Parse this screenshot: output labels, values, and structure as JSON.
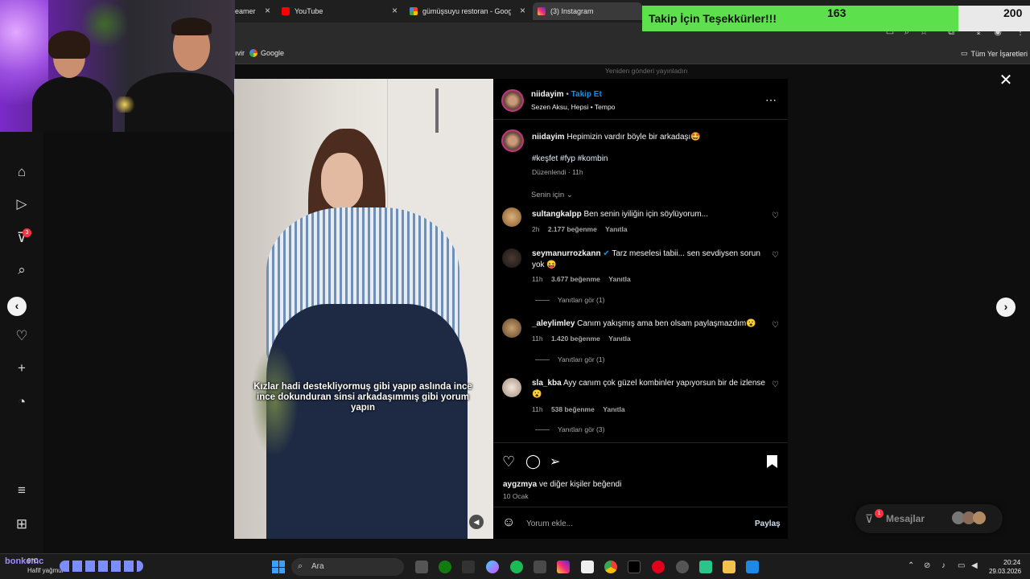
{
  "browser": {
    "tabs": [
      {
        "label": "eamer",
        "favicon_color": "#9146ff"
      },
      {
        "label": "YouTube",
        "favicon_color": "#ff0000"
      },
      {
        "label": "gümüşsuyu restoran - Google'd",
        "favicon_color": "#4285f4"
      },
      {
        "label": "(3) Instagram",
        "favicon_color": "#dd2a7b"
      }
    ],
    "bookmarks": [
      {
        "label": "ıvir"
      },
      {
        "label": "Google"
      }
    ],
    "all_bookmarks": "Tüm Yer İşaretleri"
  },
  "overlay": {
    "follow_label": "Takip İçin Teşekkürler!!!",
    "follow_count": "163",
    "follow_goal": "200",
    "follow_progress": 0.815
  },
  "instagram": {
    "reposted_notice": "Yeniden gönderi yayınladın",
    "post": {
      "username": "niidayim",
      "follow": "Takip Et",
      "audio": "Sezen Aksu, Hepsi • Tempo",
      "caption_user": "niidayim",
      "caption_text": "Hepimizin vardır böyle bir arkadaşı🤩",
      "hashtags": "#keşfet #fyp #kombin",
      "caption_meta": "Düzenlendi · 11h",
      "filter": "Senin için",
      "video_text": "Kızlar hadi destekliyormuş gibi yapıp aslında ince ince dokunduran sinsi arkadaşımmış gibi yorum yapın",
      "liked_by_prefix": "aygzmya",
      "liked_by_suffix": " ve diğer kişiler beğendi",
      "date": "10 Ocak",
      "comment_placeholder": "Yorum ekle...",
      "share": "Paylaş"
    },
    "comments": [
      {
        "user": "sultangkalpp",
        "text": "Ben senin iyiliğin için söylüyorum...",
        "time": "2h",
        "likes": "2.177 beğenme",
        "reply": "Yanıtla",
        "replies": ""
      },
      {
        "user": "seymanurrozkann",
        "text": "Tarz meselesi tabii... sen sevdiysen sorun yok 😝",
        "time": "11h",
        "likes": "3.677 beğenme",
        "reply": "Yanıtla",
        "replies": "Yanıtları gör (1)"
      },
      {
        "user": "_aleylimley",
        "text": "Canım yakışmış ama ben olsam paylaşmazdım😮",
        "time": "11h",
        "likes": "1.420 beğenme",
        "reply": "Yanıtla",
        "replies": "Yanıtları gör (1)"
      },
      {
        "user": "sla_kba",
        "text": "Ayy canım çok güzel kombinler yapıyorsun bir de izlense 😮",
        "time": "11h",
        "likes": "538 beğenme",
        "reply": "Yanıtla",
        "replies": "Yanıtları gör (3)"
      }
    ],
    "messages": "Mesajlar",
    "nav_badge": "3",
    "messages_badge": "1"
  },
  "taskbar": {
    "search": "Ara",
    "weather_text": "Hafif yağmur",
    "weather_temp": "9°C",
    "time": "20:24",
    "date": "29.03.2026",
    "chat_tag": "bonkemc"
  },
  "icons": [
    "home-icon",
    "reels-icon",
    "explore-icon",
    "search-icon",
    "heart-icon",
    "create-icon",
    "profile-icon",
    "menu-icon",
    "apps-icon",
    "prev-arrow-icon",
    "next-arrow-icon",
    "close-icon",
    "more-icon",
    "comment-icon",
    "share-icon",
    "bookmark-icon",
    "emoji-icon",
    "mute-icon"
  ]
}
